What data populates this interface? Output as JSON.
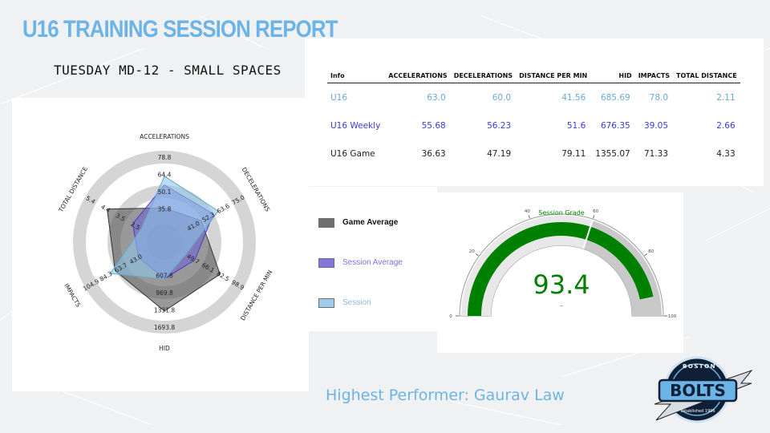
{
  "header": {
    "title": "U16 TRAINING SESSION REPORT",
    "subtitle": "TUESDAY MD-12 - SMALL SPACES"
  },
  "highlight": "Highest Performer: Gaurav Law",
  "logo": {
    "top_text": "BOSTON",
    "main_text": "BOLTS",
    "bottom_text": "Established 1996"
  },
  "colors": {
    "accent": "#6cb4e6",
    "game": "#555555",
    "session_average": "#6b5fd6",
    "session": "#8ec5e8",
    "gauge": "#008000"
  },
  "chart_data": [
    {
      "type": "radar",
      "axes": [
        "ACCELERATIONS",
        "DECELERATIONS",
        "DISTANCE PER MIN",
        "HID",
        "IMPACTS",
        "TOTAL DISTANCE"
      ],
      "tick_labels": [
        [
          "35.8",
          "50.1",
          "64.4",
          "78.8"
        ],
        [
          "41.0",
          "52.3",
          "63.6",
          "75.0"
        ],
        [
          "49.7",
          "66.1",
          "82.5",
          "98.9"
        ],
        [
          "607.8",
          "969.8",
          "1331.8",
          "1693.8"
        ],
        [
          "43.0",
          "63.7",
          "84.3",
          "104.9"
        ],
        [
          "2.5",
          "3.5",
          "4.4",
          "5.4"
        ]
      ],
      "ranges": [
        [
          21.5,
          78.8
        ],
        [
          29.7,
          75.0
        ],
        [
          33.3,
          98.9
        ],
        [
          245.8,
          1693.8
        ],
        [
          22.3,
          104.9
        ],
        [
          1.5,
          5.4
        ]
      ],
      "series": [
        {
          "name": "Game Average",
          "values": [
            36.63,
            47.19,
            79.11,
            1355.07,
            71.33,
            4.33
          ]
        },
        {
          "name": "Session Average",
          "values": [
            55.68,
            56.23,
            51.6,
            676.35,
            39.05,
            2.66
          ]
        },
        {
          "name": "Session",
          "values": [
            63.0,
            60.0,
            41.56,
            685.69,
            78.0,
            2.11
          ]
        }
      ],
      "legend": "right"
    },
    {
      "type": "table",
      "columns": [
        "Info",
        "ACCELERATIONS",
        "DECELERATIONS",
        "DISTANCE PER MIN",
        "HID",
        "IMPACTS",
        "TOTAL DISTANCE"
      ],
      "rows": [
        [
          "U16",
          "63.0",
          "60.0",
          "41.56",
          "685.69",
          "78.0",
          "2.11"
        ],
        [
          "U16 Weekly",
          "55.68",
          "56.23",
          "51.6",
          "676.35",
          "39.05",
          "2.66"
        ],
        [
          "U16 Game",
          "36.63",
          "47.19",
          "79.11",
          "1355.07",
          "71.33",
          "4.33"
        ]
      ]
    },
    {
      "type": "gauge",
      "title": "Session Grade",
      "value": 93.4,
      "value_label": "93.4",
      "delta_label": "-",
      "range": [
        0,
        100
      ],
      "ticks": [
        0,
        20,
        40,
        60,
        80,
        100
      ],
      "tick_labels": [
        "0",
        "20",
        "40",
        "60",
        "80",
        "100"
      ],
      "threshold": 60
    }
  ]
}
